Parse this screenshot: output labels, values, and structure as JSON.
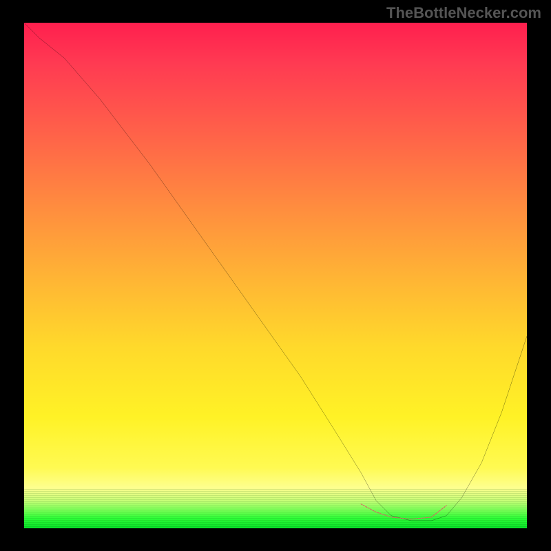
{
  "watermark": "TheBottleNecker.com",
  "chart_data": {
    "type": "line",
    "title": "",
    "xlabel": "",
    "ylabel": "",
    "xlim": [
      0,
      100
    ],
    "ylim": [
      0,
      100
    ],
    "series": [
      {
        "name": "bottleneck-curve",
        "color": "#000000",
        "x": [
          0,
          3,
          8,
          15,
          25,
          35,
          45,
          55,
          62,
          67,
          70,
          73,
          77,
          81,
          84,
          87,
          91,
          95,
          100
        ],
        "y": [
          100,
          97,
          93,
          85,
          72,
          58,
          44,
          30,
          19,
          11,
          5.5,
          2.5,
          1.5,
          1.5,
          2.5,
          6,
          13,
          23,
          38
        ]
      },
      {
        "name": "optimal-zone-marker",
        "color": "#d86666",
        "x": [
          67,
          70,
          73,
          77,
          81,
          84
        ],
        "y": [
          4.8,
          3.2,
          2.2,
          1.8,
          2.2,
          4.5
        ]
      }
    ],
    "background_gradient": {
      "top": "#ff1f4e",
      "mid_upper": "#ff8b3f",
      "mid": "#ffd92b",
      "mid_lower": "#fffa52",
      "bottom": "#08e028"
    }
  }
}
